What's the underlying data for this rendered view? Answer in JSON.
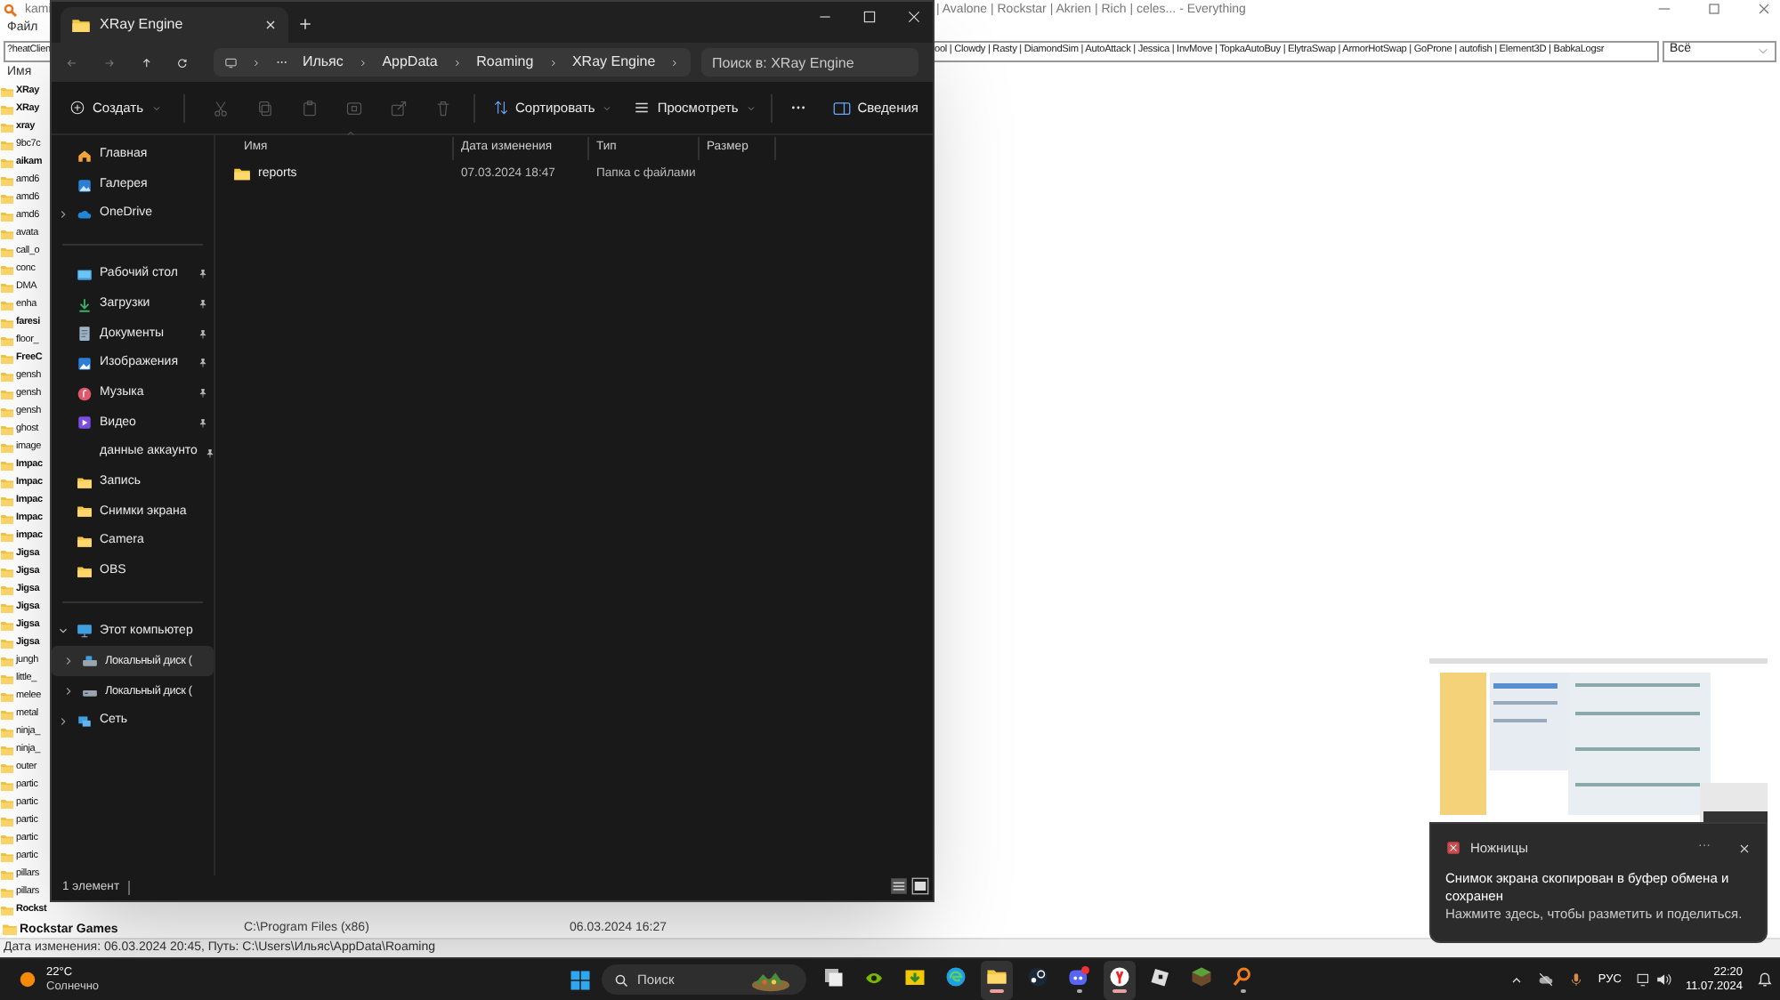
{
  "everything": {
    "title_start": "kami",
    "title_end": "| Avalone | Rockstar | Akrien | Rich | celes... - Everything",
    "menu": [
      "Файл"
    ],
    "search_start": "?heatClien",
    "search_end": "ool | Clowdy | Rasty | DiamondSim | AutoAttack | Jessica | InvMove | TopkaAutoBuy | ElytraSwap | ArmorHotSwap | GoProne | autofish | Element3D | BabkaLogsr",
    "filter": "Всё",
    "column": "Имя",
    "rows": [
      {
        "name": "XRay",
        "bold": true
      },
      {
        "name": "XRay",
        "bold": true
      },
      {
        "name": "xray",
        "bold": true
      },
      {
        "name": "9bc7c",
        "bold": false
      },
      {
        "name": "aikam",
        "bold": true
      },
      {
        "name": "amd6",
        "bold": false
      },
      {
        "name": "amd6",
        "bold": false
      },
      {
        "name": "amd6",
        "bold": false
      },
      {
        "name": "avata",
        "bold": false
      },
      {
        "name": "call_o",
        "bold": false
      },
      {
        "name": "conc",
        "bold": false
      },
      {
        "name": "DMA",
        "bold": false
      },
      {
        "name": "enha",
        "bold": false
      },
      {
        "name": "faresi",
        "bold": true
      },
      {
        "name": "floor_",
        "bold": false
      },
      {
        "name": "FreeC",
        "bold": true
      },
      {
        "name": "gensh",
        "bold": false
      },
      {
        "name": "gensh",
        "bold": false
      },
      {
        "name": "gensh",
        "bold": false
      },
      {
        "name": "ghost",
        "bold": false
      },
      {
        "name": "image",
        "bold": false
      },
      {
        "name": "Impac",
        "bold": true
      },
      {
        "name": "Impac",
        "bold": true
      },
      {
        "name": "Impac",
        "bold": true
      },
      {
        "name": "Impac",
        "bold": true
      },
      {
        "name": "impac",
        "bold": true
      },
      {
        "name": "Jigsa",
        "bold": true
      },
      {
        "name": "Jigsa",
        "bold": true
      },
      {
        "name": "Jigsa",
        "bold": true
      },
      {
        "name": "Jigsa",
        "bold": true
      },
      {
        "name": "Jigsa",
        "bold": true
      },
      {
        "name": "Jigsa",
        "bold": true
      },
      {
        "name": "jungh",
        "bold": false
      },
      {
        "name": "little_",
        "bold": false
      },
      {
        "name": "melee",
        "bold": false
      },
      {
        "name": "metal",
        "bold": false
      },
      {
        "name": "ninja_",
        "bold": false
      },
      {
        "name": "ninja_",
        "bold": false
      },
      {
        "name": "outer",
        "bold": false
      },
      {
        "name": "partic",
        "bold": false
      },
      {
        "name": "partic",
        "bold": false
      },
      {
        "name": "partic",
        "bold": false
      },
      {
        "name": "partic",
        "bold": false
      },
      {
        "name": "partic",
        "bold": false
      },
      {
        "name": "pillars",
        "bold": false
      },
      {
        "name": "pillars",
        "bold": false
      },
      {
        "name": "Rockst",
        "bold": true
      }
    ],
    "last_row": {
      "name": "Rockstar Games",
      "path": "C:\\Program Files (x86)",
      "modified": "06.03.2024 16:27"
    },
    "status": "Дата изменения: 06.03.2024 20:45, Путь: C:\\Users\\Ильяс\\AppData\\Roaming"
  },
  "explorer": {
    "tab": "XRay Engine",
    "path": [
      "Ильяс",
      "AppData",
      "Roaming",
      "XRay Engine"
    ],
    "search": {
      "placeholder": "Поиск в: XRay Engine"
    },
    "toolbar": {
      "new": "Создать",
      "sort": "Сортировать",
      "view": "Просмотреть",
      "details": "Сведения"
    },
    "sidebar": [
      [
        {
          "label": "Главная",
          "selected": false
        },
        {
          "label": "Галерея",
          "selected": false
        },
        {
          "label": "OneDrive",
          "expanded": false,
          "selected": false
        }
      ],
      [
        {
          "label": "Рабочий стол",
          "pinned": true,
          "selected": false
        },
        {
          "label": "Загрузки",
          "pinned": true,
          "selected": false
        },
        {
          "label": "Документы",
          "pinned": true,
          "selected": false
        },
        {
          "label": "Изображения",
          "pinned": true,
          "selected": false
        },
        {
          "label": "Музыка",
          "pinned": true,
          "selected": false
        },
        {
          "label": "Видео",
          "pinned": true,
          "selected": false
        },
        {
          "label": "данные аккаунто",
          "pinned": true,
          "selected": false
        },
        {
          "label": "Запись",
          "pinned": false,
          "selected": false
        },
        {
          "label": "Снимки экрана",
          "pinned": false,
          "selected": false
        },
        {
          "label": "Camera",
          "pinned": false,
          "selected": false
        },
        {
          "label": "OBS",
          "pinned": false,
          "selected": false
        }
      ],
      [
        {
          "label": "Этот компьютер",
          "expanded": true,
          "selected": false,
          "children": [
            {
              "label": "Локальный диск (",
              "expanded": false,
              "selected": true
            },
            {
              "label": "Локальный диск (",
              "expanded": false,
              "selected": false
            }
          ]
        },
        {
          "label": "Сеть",
          "expanded": false,
          "selected": false
        }
      ]
    ],
    "columns": [
      "Имя",
      "Дата изменения",
      "Тип",
      "Размер"
    ],
    "rows": [
      {
        "name": "reports",
        "modified": "07.03.2024 18:47",
        "type": "Папка с файлами"
      }
    ],
    "status": "1 элемент"
  },
  "notification": {
    "app": "Ножницы",
    "more": "···",
    "title": "Снимок экрана скопирован в буфер обмена и сохранен",
    "body": "Нажмите здесь, чтобы разметить и поделиться."
  },
  "taskbar": {
    "weather": {
      "temp": "22°C",
      "text": "Солнечно"
    },
    "search": "Поиск",
    "apps": [
      {
        "active": false,
        "running": false
      },
      {
        "active": false,
        "running": false
      },
      {
        "active": false,
        "running": false
      },
      {
        "active": false,
        "running": false
      },
      {
        "active": true,
        "running": true
      },
      {
        "active": false,
        "running": false
      },
      {
        "active": false,
        "running": true
      },
      {
        "active": true,
        "running": true
      },
      {
        "active": false,
        "running": false
      },
      {
        "active": false,
        "running": false
      },
      {
        "active": false,
        "running": true
      }
    ],
    "language": "РУС",
    "time": "22:20",
    "date": "11.07.2024"
  }
}
